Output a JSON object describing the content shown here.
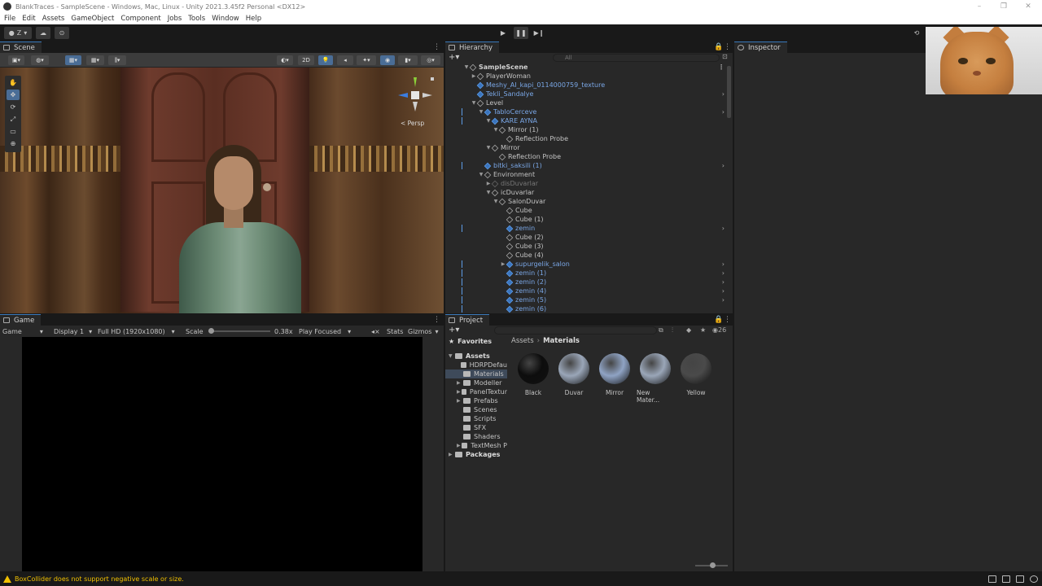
{
  "window": {
    "title": "BlankTraces - SampleScene - Windows, Mac, Linux - Unity 2021.3.45f2 Personal <DX12>",
    "controls": [
      "–",
      "❐",
      "✕"
    ]
  },
  "menu": [
    "File",
    "Edit",
    "Assets",
    "GameObject",
    "Component",
    "Jobs",
    "Tools",
    "Window",
    "Help"
  ],
  "toolbar": {
    "account_label": "Z",
    "play_icon": "play-icon",
    "pause_icon": "pause-icon",
    "step_icon": "step-icon"
  },
  "scene": {
    "tab_label": "Scene",
    "toolbar_2d": "2D",
    "persp_label": "< Persp"
  },
  "game": {
    "tab_label": "Game",
    "mode": "Game",
    "display": "Display 1",
    "resolution": "Full HD (1920x1080)",
    "scale_label": "Scale",
    "scale_value": "0.38x",
    "play_focus": "Play Focused",
    "stats": "Stats",
    "gizmos": "Gizmos"
  },
  "hierarchy": {
    "tab_label": "Hierarchy",
    "search_placeholder": "All",
    "rows": [
      {
        "label": "SampleScene",
        "depth": 0,
        "type": "scene",
        "arrow": "▼",
        "more": "⋮"
      },
      {
        "label": "PlayerWoman",
        "depth": 1,
        "type": "object",
        "arrow": "▶"
      },
      {
        "label": "Meshy_AI_kapi_0114000759_texture",
        "depth": 1,
        "type": "prefab",
        "arrow": ""
      },
      {
        "label": "Tekli_Sandalye",
        "depth": 1,
        "type": "prefab",
        "arrow": "",
        "more": "›"
      },
      {
        "label": "Level",
        "depth": 1,
        "type": "object",
        "arrow": "▼"
      },
      {
        "label": "TabloCerceve",
        "depth": 2,
        "type": "prefab",
        "arrow": "▼",
        "more": "›"
      },
      {
        "label": "KARE AYNA",
        "depth": 3,
        "type": "prefab",
        "arrow": "▼"
      },
      {
        "label": "Mirror (1)",
        "depth": 4,
        "type": "object",
        "arrow": "▼"
      },
      {
        "label": "Reflection Probe",
        "depth": 5,
        "type": "object",
        "arrow": ""
      },
      {
        "label": "Mirror",
        "depth": 3,
        "type": "object",
        "arrow": "▼"
      },
      {
        "label": "Reflection Probe",
        "depth": 4,
        "type": "object",
        "arrow": ""
      },
      {
        "label": "bitki_saksili (1)",
        "depth": 2,
        "type": "prefab",
        "arrow": "",
        "more": "›"
      },
      {
        "label": "Environment",
        "depth": 2,
        "type": "object",
        "arrow": "▼"
      },
      {
        "label": "disDuvarlar",
        "depth": 3,
        "type": "disabled",
        "arrow": "▶"
      },
      {
        "label": "icDuvarlar",
        "depth": 3,
        "type": "object",
        "arrow": "▼"
      },
      {
        "label": "SalonDuvar",
        "depth": 4,
        "type": "object",
        "arrow": "▼"
      },
      {
        "label": "Cube",
        "depth": 5,
        "type": "object",
        "arrow": ""
      },
      {
        "label": "Cube (1)",
        "depth": 5,
        "type": "object",
        "arrow": ""
      },
      {
        "label": "zemin",
        "depth": 5,
        "type": "prefab",
        "arrow": "",
        "more": "›"
      },
      {
        "label": "Cube (2)",
        "depth": 5,
        "type": "object",
        "arrow": ""
      },
      {
        "label": "Cube (3)",
        "depth": 5,
        "type": "object",
        "arrow": ""
      },
      {
        "label": "Cube (4)",
        "depth": 5,
        "type": "object",
        "arrow": ""
      },
      {
        "label": "supurgelik_salon",
        "depth": 5,
        "type": "prefab",
        "arrow": "▶",
        "more": "›"
      },
      {
        "label": "zemin (1)",
        "depth": 5,
        "type": "prefab",
        "arrow": "",
        "more": "›"
      },
      {
        "label": "zemin (2)",
        "depth": 5,
        "type": "prefab",
        "arrow": "",
        "more": "›"
      },
      {
        "label": "zemin (4)",
        "depth": 5,
        "type": "prefab",
        "arrow": "",
        "more": "›"
      },
      {
        "label": "zemin (5)",
        "depth": 5,
        "type": "prefab",
        "arrow": "",
        "more": "›"
      },
      {
        "label": "zemin (6)",
        "depth": 5,
        "type": "prefab",
        "arrow": "",
        "more": ""
      }
    ]
  },
  "inspector": {
    "tab_label": "Inspector"
  },
  "project": {
    "tab_label": "Project",
    "count": "26",
    "favorites": "Favorites",
    "tree": [
      {
        "label": "Assets",
        "depth": 0,
        "arrow": "▼",
        "bold": true
      },
      {
        "label": "HDRPDefau",
        "depth": 1,
        "arrow": ""
      },
      {
        "label": "Materials",
        "depth": 1,
        "arrow": "",
        "selected": true
      },
      {
        "label": "Modeller",
        "depth": 1,
        "arrow": "▶"
      },
      {
        "label": "PanelTextur",
        "depth": 1,
        "arrow": "▶"
      },
      {
        "label": "Prefabs",
        "depth": 1,
        "arrow": "▶"
      },
      {
        "label": "Scenes",
        "depth": 1,
        "arrow": ""
      },
      {
        "label": "Scripts",
        "depth": 1,
        "arrow": ""
      },
      {
        "label": "SFX",
        "depth": 1,
        "arrow": ""
      },
      {
        "label": "Shaders",
        "depth": 1,
        "arrow": ""
      },
      {
        "label": "TextMesh P",
        "depth": 1,
        "arrow": "▶"
      },
      {
        "label": "Packages",
        "depth": 0,
        "arrow": "▶",
        "bold": true
      }
    ],
    "breadcrumb": [
      "Assets",
      "Materials"
    ],
    "assets": [
      {
        "label": "Black",
        "color": "#0d0d0d"
      },
      {
        "label": "Duvar",
        "color": "#9aa6b8"
      },
      {
        "label": "Mirror",
        "color": "#8fa3c4"
      },
      {
        "label": "New Mater...",
        "color": "#9aa6b8"
      },
      {
        "label": "Yellow",
        "color": "#4a4a4a"
      }
    ]
  },
  "status": {
    "message": "BoxCollider does not support negative scale or size."
  }
}
